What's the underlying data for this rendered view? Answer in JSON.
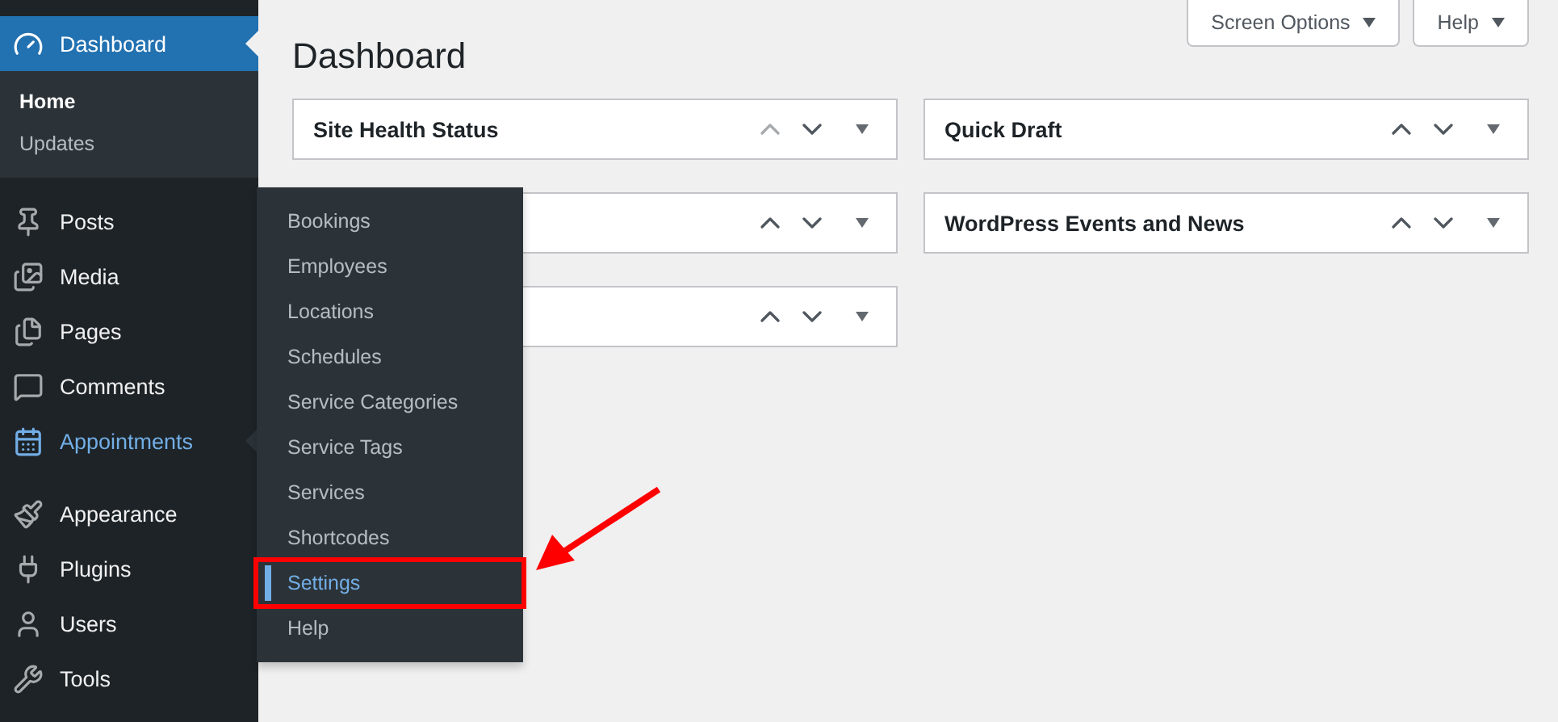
{
  "sidebar": {
    "items": [
      {
        "kind": "dashboard",
        "label": "Dashboard",
        "selected": true,
        "open": false,
        "submenu": [
          {
            "label": "Home",
            "selected": true
          },
          {
            "label": "Updates",
            "selected": false
          }
        ]
      },
      {
        "kind": "posts",
        "label": "Posts",
        "selected": false,
        "open": false
      },
      {
        "kind": "media",
        "label": "Media",
        "selected": false,
        "open": false
      },
      {
        "kind": "pages",
        "label": "Pages",
        "selected": false,
        "open": false
      },
      {
        "kind": "comments",
        "label": "Comments",
        "selected": false,
        "open": false
      },
      {
        "kind": "appointments",
        "label": "Appointments",
        "selected": false,
        "open": true
      },
      {
        "kind": "appearance",
        "label": "Appearance",
        "selected": false,
        "open": false
      },
      {
        "kind": "plugins",
        "label": "Plugins",
        "selected": false,
        "open": false
      },
      {
        "kind": "users",
        "label": "Users",
        "selected": false,
        "open": false
      },
      {
        "kind": "tools",
        "label": "Tools",
        "selected": false,
        "open": false
      }
    ]
  },
  "flyout_menu": {
    "items": [
      {
        "label": "Bookings",
        "selected": false
      },
      {
        "label": "Employees",
        "selected": false
      },
      {
        "label": "Locations",
        "selected": false
      },
      {
        "label": "Schedules",
        "selected": false
      },
      {
        "label": "Service Categories",
        "selected": false
      },
      {
        "label": "Service Tags",
        "selected": false
      },
      {
        "label": "Services",
        "selected": false
      },
      {
        "label": "Shortcodes",
        "selected": false
      },
      {
        "label": "Settings",
        "selected": true
      },
      {
        "label": "Help",
        "selected": false
      }
    ]
  },
  "header": {
    "title": "Dashboard",
    "buttons": [
      "Screen Options",
      "Help"
    ]
  },
  "columns": [
    [
      {
        "title": "Site Health Status",
        "up_disabled": true
      },
      {
        "up_disabled": false
      },
      {
        "up_disabled": false
      }
    ],
    [
      {
        "title": "Quick Draft",
        "up_disabled": false
      },
      {
        "title": "WordPress Events and News",
        "up_disabled": false
      }
    ]
  ]
}
